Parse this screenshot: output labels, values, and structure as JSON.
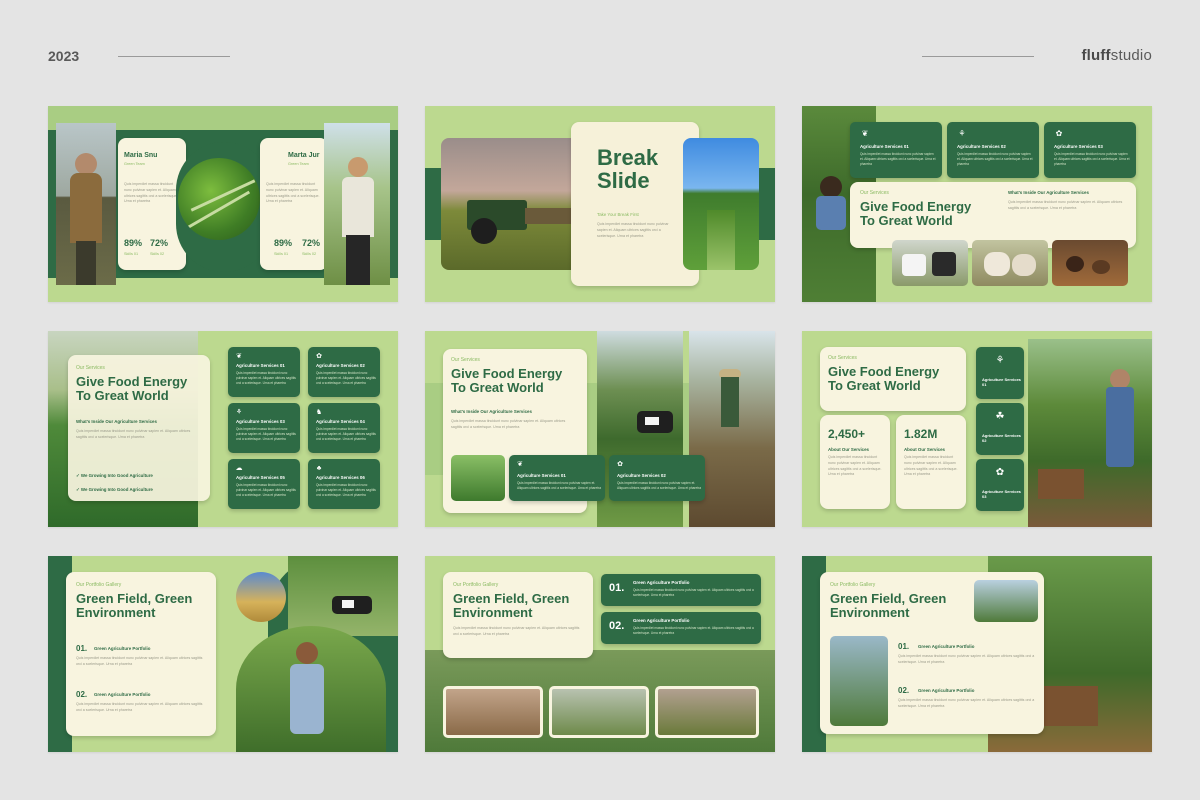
{
  "header": {
    "year": "2023",
    "brand_a": "fluff",
    "brand_b": "studio"
  },
  "lorem": "Quis imperdiet massa tincidunt nunc pulvinar sapien et. Aliquam ultrices sagittis orci a scelerisque. Urna et pharetra",
  "s1": {
    "p1_name": "Maria Snu",
    "p1_role": "Green Team",
    "p2_name": "Marta Jur",
    "p2_role": "Green Team",
    "stat_a": "89%",
    "stat_b": "72%",
    "skill_a": "Skills 01",
    "skill_b": "Skills 02"
  },
  "s2": {
    "title_a": "Break",
    "title_b": "Slide",
    "tag": "Take Your Break First"
  },
  "services": {
    "title_a": "Give Food Energy",
    "title_b": "To Great World",
    "tag": "Our Services",
    "inside": "What's Inside Our Agriculture Services",
    "s01": "Agriculture Services 01",
    "s02": "Agriculture Services 02",
    "s03": "Agriculture Services 03",
    "s04": "Agriculture Services 04",
    "s05": "Agriculture Services 05",
    "s06": "Agriculture Services 06",
    "check": "We Growing Into Good Agriculture"
  },
  "s6": {
    "n1": "2,450+",
    "n2": "1.82M",
    "l1": "About Our Services",
    "l2": "About Our Services",
    "i1": "Agriculture Services 01",
    "i2": "Agriculture Services 02",
    "i3": "Agriculture Services 03"
  },
  "portfolio": {
    "tag": "Our Portfolio Gallery",
    "title_a": "Green Field, Green",
    "title_b": "Environment",
    "n1": "01.",
    "n2": "02.",
    "item": "Green Agriculture Portfolio"
  },
  "colors": {
    "dark": "#2e6b45",
    "light": "#bcd98f",
    "cream": "#f8f4df"
  }
}
